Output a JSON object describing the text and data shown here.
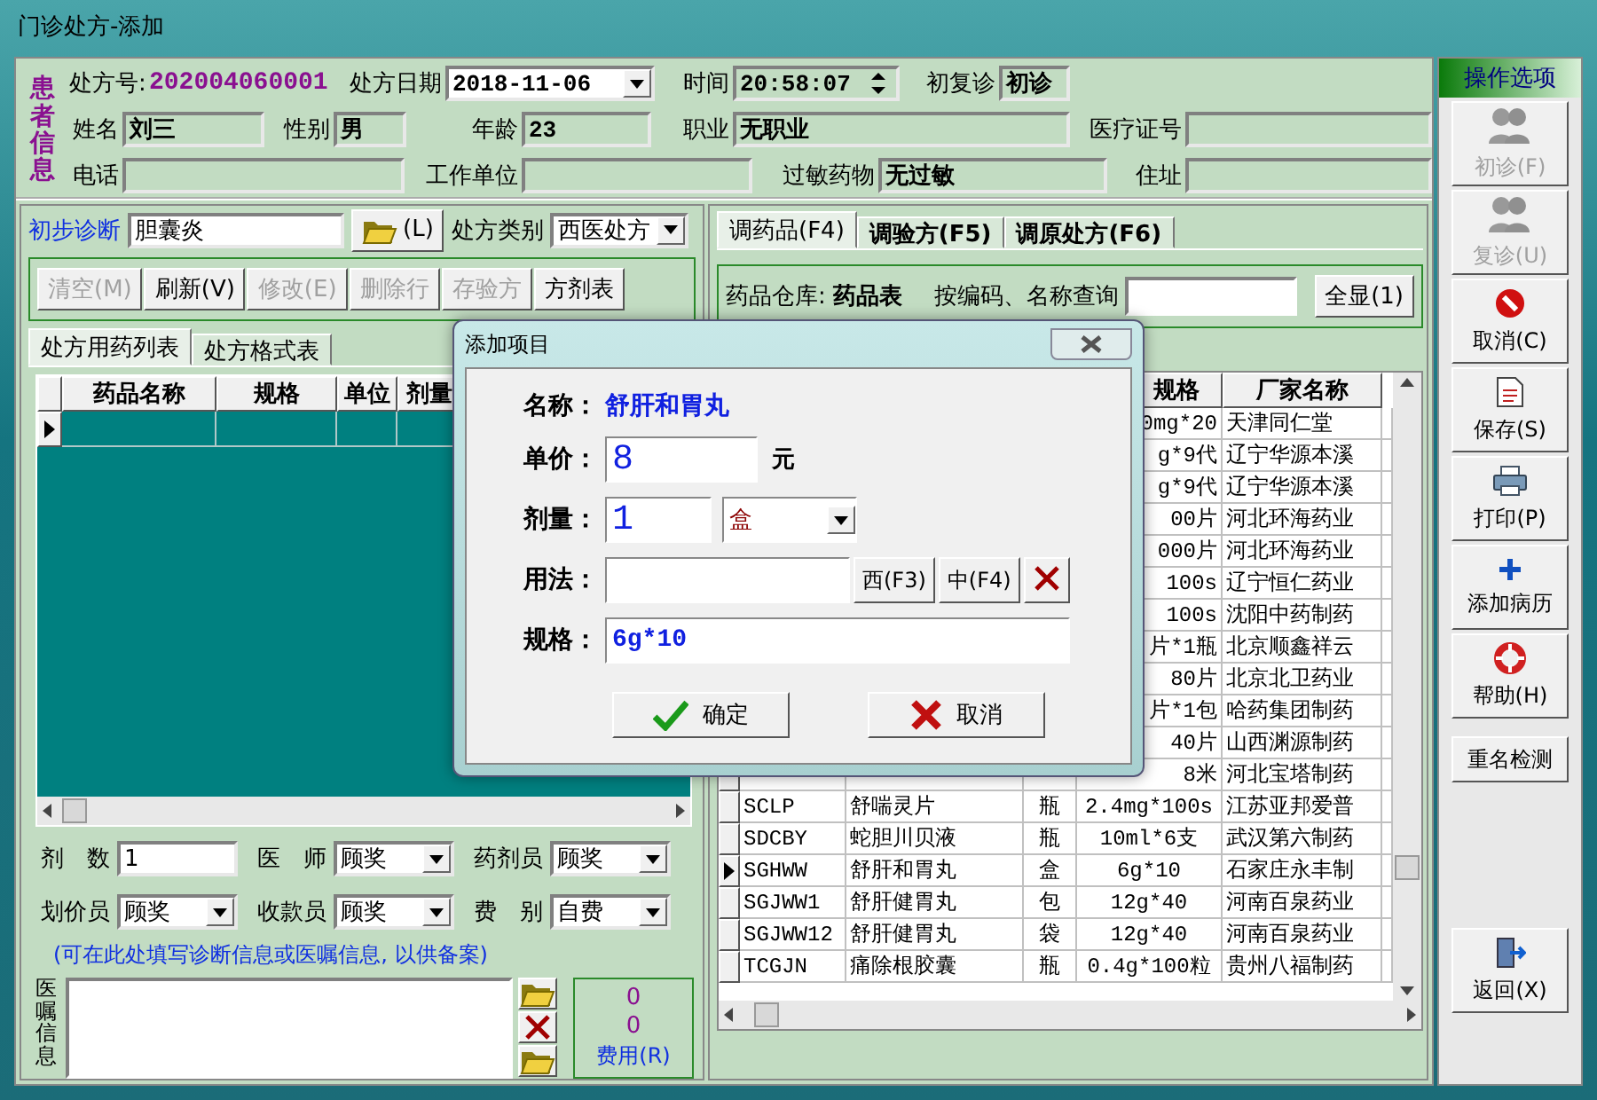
{
  "window": {
    "title": "门诊处方-添加"
  },
  "patient": {
    "section_label": "患者信息",
    "fields": [
      {
        "kind": "plain",
        "label": "处方号:",
        "value": "202004060001"
      },
      {
        "kind": "dropdown",
        "label": "处方日期",
        "value": "2018-11-06"
      },
      {
        "kind": "spinner",
        "label": "时间",
        "value": "20:58:07"
      },
      {
        "kind": "text",
        "label": "初复诊",
        "value": "初诊"
      },
      {
        "kind": "text",
        "label": "姓名",
        "value": "刘三"
      },
      {
        "kind": "text",
        "label": "性别",
        "value": "男"
      },
      {
        "kind": "text",
        "label": "年龄",
        "value": "23"
      },
      {
        "kind": "text",
        "label": "职业",
        "value": "无职业"
      },
      {
        "kind": "text",
        "label": "医疗证号"
      },
      {
        "kind": "text",
        "label": "电话"
      },
      {
        "kind": "text",
        "label": "工作单位"
      },
      {
        "kind": "text",
        "label": "过敏药物",
        "value": "无过敏"
      },
      {
        "kind": "text",
        "label": "住址"
      }
    ]
  },
  "diagnosis": {
    "label": "初步诊断",
    "value": "胆囊炎",
    "open_button": "(L)",
    "type_label": "处方类别",
    "type_value": "西医处方"
  },
  "toolbar": [
    {
      "label": "清空(M)",
      "disabled": true
    },
    {
      "label": "刷新(V)",
      "disabled": false
    },
    {
      "label": "修改(E)",
      "disabled": true
    },
    {
      "label": "删除行",
      "disabled": true
    },
    {
      "label": "存验方",
      "disabled": true
    },
    {
      "label": "方剂表",
      "disabled": false
    }
  ],
  "left_tabs": [
    {
      "label": "处方用药列表",
      "selected": true
    },
    {
      "label": "处方格式表",
      "selected": false
    }
  ],
  "prescription_grid": {
    "columns": [
      "药品名称",
      "规格",
      "单位",
      "剂量"
    ],
    "rows": [
      {
        "selected": true
      }
    ]
  },
  "staff": [
    {
      "kind": "text",
      "label": "剂　数",
      "value": "1"
    },
    {
      "kind": "dropdown",
      "label": "医　师",
      "value": "顾奖"
    },
    {
      "kind": "dropdown",
      "label": "药剂员",
      "value": "顾奖"
    },
    {
      "kind": "dropdown",
      "label": "划价员",
      "value": "顾奖"
    },
    {
      "kind": "dropdown",
      "label": "收款员",
      "value": "顾奖"
    },
    {
      "kind": "dropdown",
      "label": "费　别",
      "value": "自费"
    }
  ],
  "note_hint": "(可在此处填写诊断信息或医嘱信息, 以供备案)",
  "advice": {
    "label": "医嘱信息"
  },
  "fee": {
    "values": [
      "0",
      "0"
    ],
    "button": "费用(R)"
  },
  "right_tabs": [
    {
      "label": "调药品(F4)",
      "selected": true
    },
    {
      "label": "调验方(F5)",
      "selected": false
    },
    {
      "label": "调原处方(F6)",
      "selected": false
    }
  ],
  "drug_search": {
    "warehouse_label": "药品仓库:",
    "warehouse": "药品表",
    "query_label": "按编码、名称查询",
    "show_all": "全显(1)"
  },
  "drug_table": {
    "spec_header": "规格",
    "maker_header": "厂家名称",
    "rows": [
      {
        "spec": "0mg*20",
        "maker": "天津同仁堂"
      },
      {
        "spec": "g*9代",
        "maker": "辽宁华源本溪"
      },
      {
        "spec": "g*9代",
        "maker": "辽宁华源本溪"
      },
      {
        "spec": "00片",
        "maker": "河北环海药业"
      },
      {
        "spec": "000片",
        "maker": "河北环海药业"
      },
      {
        "spec": "100s",
        "maker": "辽宁恒仁药业"
      },
      {
        "spec": "100s",
        "maker": "沈阳中药制药"
      },
      {
        "spec": "片*1瓶",
        "maker": "北京顺鑫祥云"
      },
      {
        "spec": "80片",
        "maker": "北京北卫药业"
      },
      {
        "spec": "片*1包",
        "maker": "哈药集团制药"
      },
      {
        "spec": "40片",
        "maker": "山西渊源制药"
      },
      {
        "spec": "8米",
        "maker": "河北宝塔制药"
      },
      {
        "code": "SCLP",
        "name": "舒喘灵片",
        "unit": "瓶",
        "spec": "2.4mg*100s",
        "maker": "江苏亚邦爱普",
        "selected": false
      },
      {
        "code": "SDCBY",
        "name": "蛇胆川贝液",
        "unit": "瓶",
        "spec": "10ml*6支",
        "maker": "武汉第六制药",
        "selected": false
      },
      {
        "code": "SGHWW",
        "name": "舒肝和胃丸",
        "unit": "盒",
        "spec": "6g*10",
        "maker": "石家庄永丰制",
        "selected": true
      },
      {
        "code": "SGJWW1",
        "name": "舒肝健胃丸",
        "unit": "包",
        "spec": "12g*40",
        "maker": "河南百泉药业",
        "selected": false
      },
      {
        "code": "SGJWW12",
        "name": "舒肝健胃丸",
        "unit": "袋",
        "spec": "12g*40",
        "maker": "河南百泉药业",
        "selected": false
      },
      {
        "code": "TCGJN",
        "name": "痛除根胶囊",
        "unit": "瓶",
        "spec": "0.4g*100粒",
        "maker": "贵州八福制药",
        "selected": false
      }
    ]
  },
  "dialog": {
    "title": "添加项目",
    "name_label": "名称：",
    "name": "舒肝和胃丸",
    "price_label": "单价：",
    "price": "8",
    "price_unit": "元",
    "dose_label": "剂量：",
    "dose": "1",
    "dose_unit": "盒",
    "usage_label": "用法：",
    "usage_buttons": [
      "西(F3)",
      "中(F4)"
    ],
    "spec_label": "规格：",
    "spec": "6g*10",
    "ok": "确定",
    "cancel": "取消"
  },
  "sidebar": {
    "title": "操作选项",
    "buttons": [
      {
        "kind": "people",
        "label": "初诊(F)",
        "disabled": true
      },
      {
        "kind": "people",
        "label": "复诊(U)",
        "disabled": true
      },
      {
        "kind": "stop",
        "label": "取消(C)",
        "disabled": false
      },
      {
        "kind": "save",
        "label": "保存(S)",
        "disabled": false
      },
      {
        "kind": "print",
        "label": "打印(P)",
        "disabled": false
      },
      {
        "kind": "plus",
        "label": "添加病历",
        "disabled": false
      },
      {
        "kind": "help",
        "label": "帮助(H)",
        "disabled": false
      },
      {
        "kind": "plain",
        "label": "重名检测",
        "disabled": false
      },
      {
        "kind": "exit",
        "label": "返回(X)",
        "disabled": false
      }
    ]
  }
}
